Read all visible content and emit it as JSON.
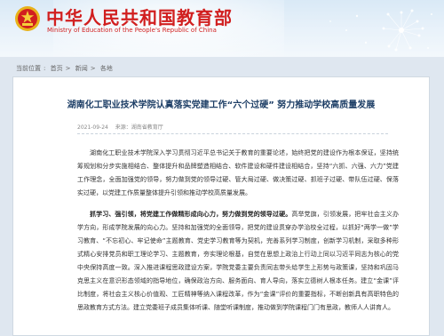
{
  "header": {
    "site_title_cn": "中华人民共和国教育部",
    "site_title_en": "Ministry of Education of the People's Republic of China",
    "brand_color": "#d11f1f"
  },
  "breadcrumb": {
    "items": [
      "当前位置",
      "首页",
      "新闻",
      "各地"
    ]
  },
  "article": {
    "title": "湖南化工职业技术学院认真落实党建工作“六个过硬” 努力推动学校高质量发展",
    "date": "2021-09-24",
    "source": "来源：湖南省教育厅",
    "para1": "湖南化工职业技术学院深入学习贯彻习近平总书记关于教育的重要论述，始终把党的建设作为根本保证，坚持统筹规划和分步实施相结合、整体提升和品牌塑造相结合、软件建设和硬件建设相结合，坚持“六抓、六强、六力”党建工作理念，全面加强党的领导，努力做到党的领导过硬、管大局过硬、做决策过硬、抓班子过硬、带队伍过硬、保落实过硬，以党建工作质量整体提升引领和推动学校高质量发展。",
    "para2_bold": "抓学习、强引领，将党建工作做精形成向心力，努力做到党的领导过硬。",
    "para2_rest": "高举党旗，引领发展，把牢社会主义办学方向，形成学院发展的向心力。坚持和加强党的全面领导，把党的建设贯穿办学治校全过程，以抓好“两学一做”学习教育、“不忘初心、牢记使命”主题教育、党史学习教育等为契机，完善系列学习制度，创新学习机制，采取多种形式精心安排党员和职工理论学习、主题教育，夯实理论根基，自觉在思想上政治上行动上同以习近平同志为核心的党中央保持高度一致。深入推进课程思政建设方案，学院党委主要负责同志带头给学生上形势与政策课，坚持和巩固马克思主义在意识形态领域的指导地位，确保政治方向、服务面向、育人导向，落实立德树人根本任务。建立“金课”评比制度，将社会主义核心价值观、工匠精神等纳入课程改革，作为“金课”评价的重要指标，不断创新具有高职特色的思政教育方式方法。建立党委班子成员集体听课、随堂听课制度，推动做到学院课程门门有思政，教师人人讲育人。"
  }
}
